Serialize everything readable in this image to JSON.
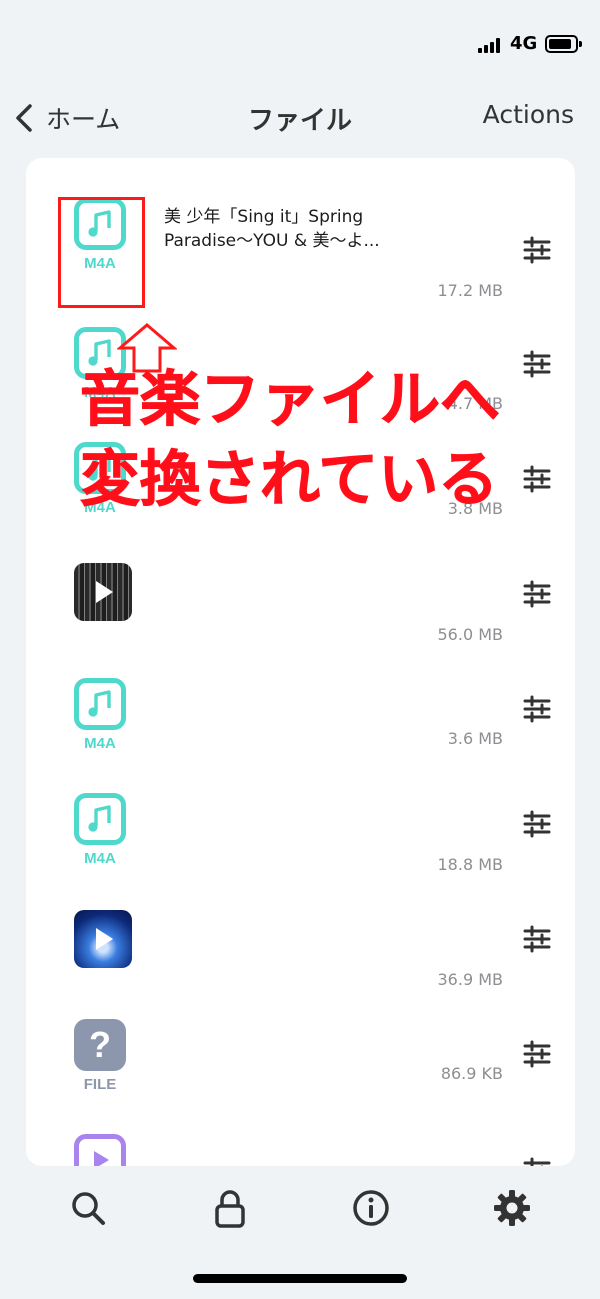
{
  "status_bar": {
    "network": "4G"
  },
  "nav": {
    "back_label": "ホーム",
    "title": "ファイル",
    "actions_label": "Actions"
  },
  "files": [
    {
      "icon": "m4a",
      "type_label": "M4A",
      "name": "美 少年「Sing it」Spring Paradise〜YOU & 美〜よ...",
      "size": "17.2 MB"
    },
    {
      "icon": "m4a",
      "type_label": "M4A",
      "name": "",
      "size": "4.7 MB"
    },
    {
      "icon": "m4a",
      "type_label": "M4A",
      "name": "",
      "size": "3.8 MB"
    },
    {
      "icon": "video-dark",
      "type_label": "",
      "name": "",
      "size": "56.0 MB"
    },
    {
      "icon": "m4a",
      "type_label": "M4A",
      "name": "",
      "size": "3.6 MB"
    },
    {
      "icon": "m4a",
      "type_label": "M4A",
      "name": "",
      "size": "18.8 MB"
    },
    {
      "icon": "video-blue",
      "type_label": "",
      "name": "",
      "size": "36.9 MB"
    },
    {
      "icon": "unknown",
      "type_label": "FILE",
      "name": "",
      "size": "86.9 KB"
    },
    {
      "icon": "video-purple",
      "type_label": "",
      "name": "",
      "size": ""
    }
  ],
  "annotation": {
    "line1": "音楽ファイルへ",
    "line2": "変換されている",
    "color": "#ff0f1a"
  },
  "tabs": [
    {
      "name": "search-icon"
    },
    {
      "name": "lock-icon"
    },
    {
      "name": "info-icon"
    },
    {
      "name": "gear-icon"
    }
  ],
  "colors": {
    "accent": "#4fd8cc",
    "background": "#eff3f6",
    "unknown_icon": "#8c97ad",
    "video_icon": "#a983ee"
  }
}
